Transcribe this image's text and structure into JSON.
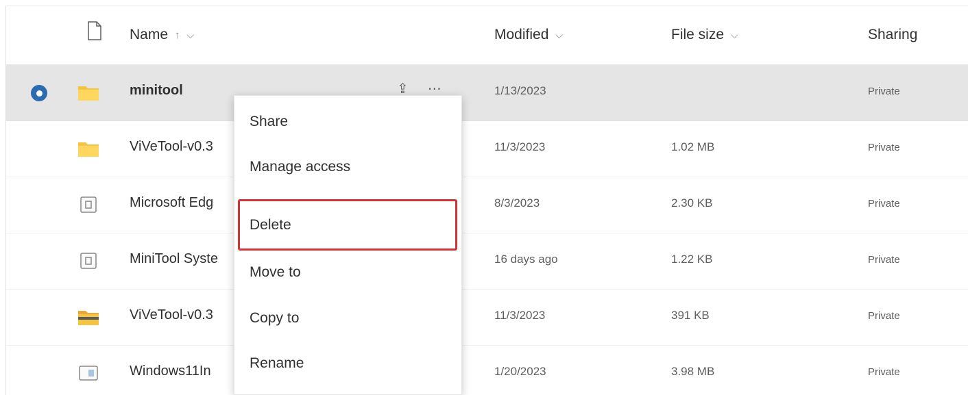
{
  "columns": {
    "name": "Name",
    "modified": "Modified",
    "file_size": "File size",
    "sharing": "Sharing"
  },
  "header_icons": {
    "file": "file-icon",
    "name_sort": "arrow-up-icon",
    "name_menu": "chevron-down-icon",
    "modified_menu": "chevron-down-icon",
    "size_menu": "chevron-down-icon"
  },
  "rows": [
    {
      "name": "minitool",
      "modified": "1/13/2023",
      "size": "",
      "sharing": "Private",
      "icon": "folder-icon",
      "selected": true
    },
    {
      "name": "ViVeTool-v0.3",
      "modified": "11/3/2023",
      "size": "1.02 MB",
      "sharing": "Private",
      "icon": "folder-icon"
    },
    {
      "name": "Microsoft Edg",
      "modified": "8/3/2023",
      "size": "2.30 KB",
      "sharing": "Private",
      "icon": "file-icon"
    },
    {
      "name": "MiniTool Syste",
      "modified": "16 days ago",
      "size": "1.22 KB",
      "sharing": "Private",
      "icon": "file-icon"
    },
    {
      "name": "ViVeTool-v0.3",
      "modified": "11/3/2023",
      "size": "391 KB",
      "sharing": "Private",
      "icon": "zip-folder-icon"
    },
    {
      "name": "Windows11In",
      "modified": "1/20/2023",
      "size": "3.98 MB",
      "sharing": "Private",
      "icon": "image-file-icon"
    }
  ],
  "context_menu": {
    "items": [
      "Share",
      "Manage access",
      "Delete",
      "Move to",
      "Copy to",
      "Rename"
    ],
    "highlighted": "Delete"
  },
  "colors": {
    "selection": "#e5e5e5",
    "check": "#2b6cb0",
    "folder": "#f4c542",
    "highlight_border": "#d13438"
  }
}
